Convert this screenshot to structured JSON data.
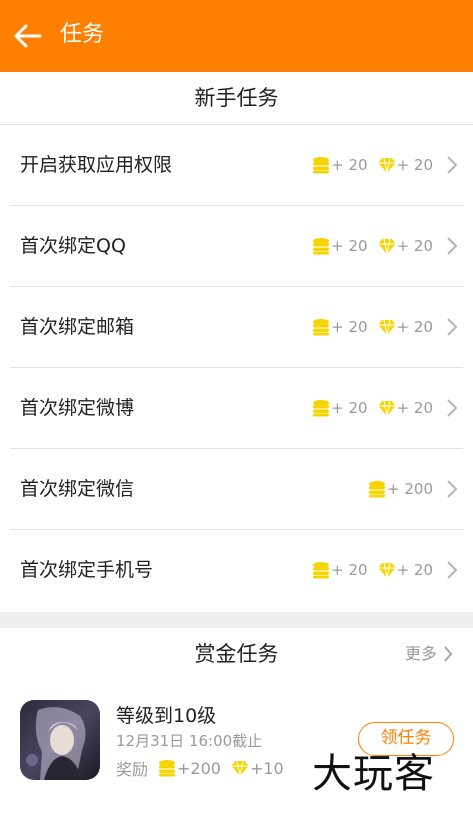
{
  "header": {
    "title": "任务"
  },
  "newbie_section": {
    "title": "新手任务"
  },
  "newbie_tasks": [
    {
      "label": "开启获取应用权限",
      "coins": "+ 20",
      "gems": "+ 20"
    },
    {
      "label": "首次绑定QQ",
      "coins": "+ 20",
      "gems": "+ 20"
    },
    {
      "label": "首次绑定邮箱",
      "coins": "+ 20",
      "gems": "+ 20"
    },
    {
      "label": "首次绑定微博",
      "coins": "+ 20",
      "gems": "+ 20"
    },
    {
      "label": "首次绑定微信",
      "coins": "+ 200"
    },
    {
      "label": "首次绑定手机号",
      "coins": "+ 20",
      "gems": "+ 20"
    }
  ],
  "bounty_section": {
    "title": "赏金任务",
    "more": "更多"
  },
  "bounty_task": {
    "title": "等级到10级",
    "deadline": "12月31日 16:00截止",
    "reward_label": "奖励",
    "coins": "+200",
    "gems": "+10",
    "button": "领任务"
  },
  "watermark": "大玩客",
  "colors": {
    "accent": "#ff7f00",
    "coin": "#f5d400",
    "muted": "#9a9a9a"
  }
}
